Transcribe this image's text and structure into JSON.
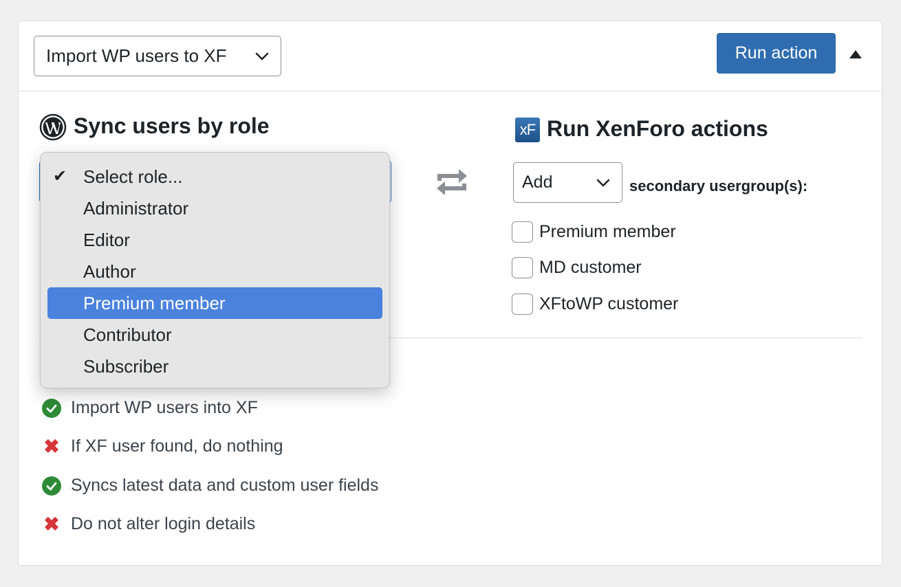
{
  "header": {
    "action_select": "Import WP users to XF",
    "run_button": "Run action"
  },
  "wp_section": {
    "title": "Sync users by role",
    "logo_icon": "wordpress-icon",
    "role_dropdown": {
      "selected": "Select role...",
      "options": [
        "Select role...",
        "Administrator",
        "Editor",
        "Author",
        "Premium member",
        "Contributor",
        "Subscriber"
      ],
      "highlighted": "Premium member"
    }
  },
  "xf_section": {
    "title": "Run XenForo actions",
    "logo_text": "xF",
    "group_action": "Add",
    "group_suffix": "secondary usergroup(s):",
    "usergroups": [
      {
        "label": "Premium member",
        "checked": false
      },
      {
        "label": "MD customer",
        "checked": false
      },
      {
        "label": "XFtoWP customer",
        "checked": false
      }
    ]
  },
  "summary": [
    {
      "status": "ok",
      "text": "Import WP users into XF"
    },
    {
      "status": "no",
      "text": "If XF user found, do nothing"
    },
    {
      "status": "ok",
      "text": "Syncs latest data and custom user fields"
    },
    {
      "status": "no",
      "text": "Do not alter login details"
    }
  ],
  "colors": {
    "primary": "#2f6db0",
    "highlight": "#4a82dd",
    "ok": "#2e8a37",
    "no": "#d63638"
  }
}
